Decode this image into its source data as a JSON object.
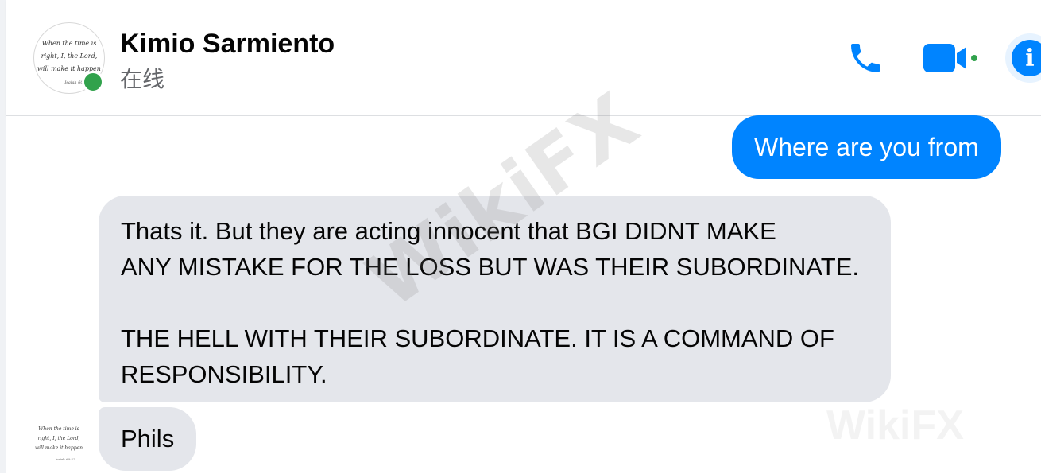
{
  "header": {
    "contact_name": "Kimio Sarmiento",
    "status": "在线",
    "avatar_text": [
      "When the time is",
      "right, I, the Lord,",
      "will make it happen",
      "Isaiah 60:22"
    ],
    "actions": [
      "phone-icon",
      "video-camera-icon",
      "info-icon"
    ],
    "online": true
  },
  "messages": {
    "outgoing_1": "Where are you from",
    "incoming_1": {
      "line_1": "Thats it. But they are acting innocent that BGI DIDNT MAKE",
      "line_2": "ANY MISTAKE FOR THE LOSS BUT WAS THEIR SUBORDINATE.",
      "line_3": "THE HELL WITH THEIR SUBORDINATE. IT IS A  COMMAND OF",
      "line_4": "RESPONSIBILITY."
    },
    "incoming_2": "Phils"
  },
  "watermark": {
    "text": "WikiFX",
    "text_2": "WikiFX"
  },
  "colors": {
    "accent": "#0084ff",
    "incoming_bubble": "#e4e6eb",
    "online": "#31a24c"
  }
}
